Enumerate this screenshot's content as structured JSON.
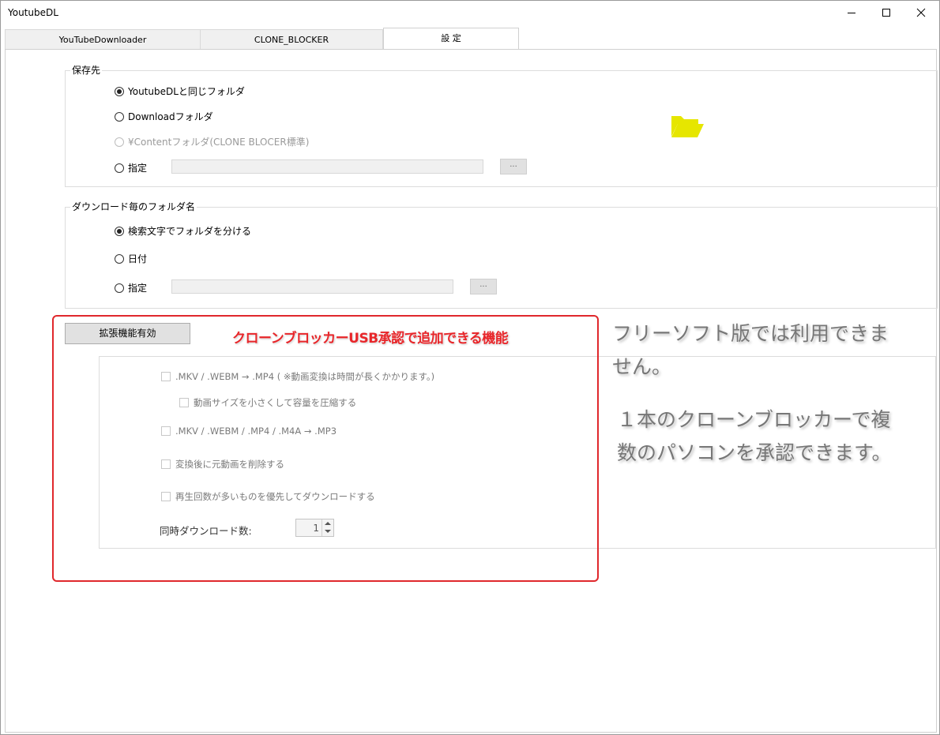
{
  "window": {
    "title": "YoutubeDL"
  },
  "tabs": [
    {
      "label": "YouTubeDownloader"
    },
    {
      "label": "CLONE_BLOCKER"
    },
    {
      "label": "設 定"
    }
  ],
  "save_location": {
    "legend": "保存先",
    "options": [
      {
        "label": "YoutubeDLと同じフォルダ",
        "checked": true,
        "enabled": true
      },
      {
        "label": "Downloadフォルダ",
        "checked": false,
        "enabled": true
      },
      {
        "label": "¥Contentフォルダ(CLONE BLOCER標準)",
        "checked": false,
        "enabled": false
      },
      {
        "label": "指定",
        "checked": false,
        "enabled": true
      }
    ],
    "browse_label": "...",
    "folder_icon_color": "#e6e600"
  },
  "folder_name": {
    "legend": "ダウンロード毎のフォルダ名",
    "options": [
      {
        "label": "検索文字でフォルダを分ける",
        "checked": true
      },
      {
        "label": "日付",
        "checked": false
      },
      {
        "label": "指定",
        "checked": false
      }
    ],
    "browse_label": "..."
  },
  "extended": {
    "enable_button": "拡張機能有効",
    "options": [
      {
        "label": ".MKV / .WEBM → .MP4 ( ※動画変換は時間が長くかかります。)"
      },
      {
        "label": "動画サイズを小さくして容量を圧縮する"
      },
      {
        "label": ".MKV / .WEBM / .MP4 / .M4A → .MP3"
      },
      {
        "label": "変換後に元動画を削除する"
      },
      {
        "label": "再生回数が多いものを優先してダウンロードする"
      }
    ],
    "concurrent_label": "同時ダウンロード数:",
    "concurrent_value": "1"
  },
  "annotations": {
    "red_caption": "クローンブロッカーUSB承認で追加できる機能",
    "note1_line1": "フリーソフト版では利用できま",
    "note1_line2": "せん。",
    "note2_line1": "１本のクローンブロッカーで複",
    "note2_line2": "数のパソコンを承認できます。",
    "red_color": "#e0282c"
  }
}
